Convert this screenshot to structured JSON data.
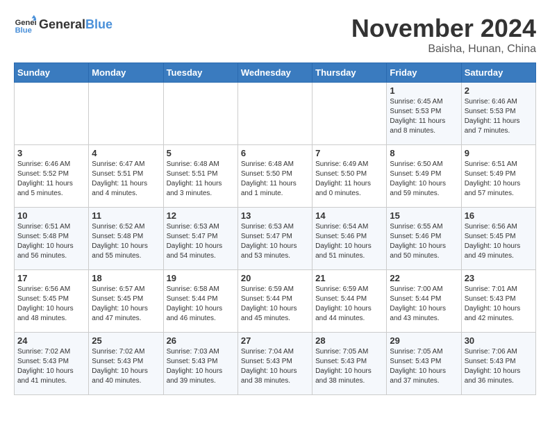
{
  "header": {
    "logo": "GeneralBlue",
    "month": "November 2024",
    "location": "Baisha, Hunan, China"
  },
  "weekdays": [
    "Sunday",
    "Monday",
    "Tuesday",
    "Wednesday",
    "Thursday",
    "Friday",
    "Saturday"
  ],
  "weeks": [
    [
      {
        "day": "",
        "info": ""
      },
      {
        "day": "",
        "info": ""
      },
      {
        "day": "",
        "info": ""
      },
      {
        "day": "",
        "info": ""
      },
      {
        "day": "",
        "info": ""
      },
      {
        "day": "1",
        "info": "Sunrise: 6:45 AM\nSunset: 5:53 PM\nDaylight: 11 hours and 8 minutes."
      },
      {
        "day": "2",
        "info": "Sunrise: 6:46 AM\nSunset: 5:53 PM\nDaylight: 11 hours and 7 minutes."
      }
    ],
    [
      {
        "day": "3",
        "info": "Sunrise: 6:46 AM\nSunset: 5:52 PM\nDaylight: 11 hours and 5 minutes."
      },
      {
        "day": "4",
        "info": "Sunrise: 6:47 AM\nSunset: 5:51 PM\nDaylight: 11 hours and 4 minutes."
      },
      {
        "day": "5",
        "info": "Sunrise: 6:48 AM\nSunset: 5:51 PM\nDaylight: 11 hours and 3 minutes."
      },
      {
        "day": "6",
        "info": "Sunrise: 6:48 AM\nSunset: 5:50 PM\nDaylight: 11 hours and 1 minute."
      },
      {
        "day": "7",
        "info": "Sunrise: 6:49 AM\nSunset: 5:50 PM\nDaylight: 11 hours and 0 minutes."
      },
      {
        "day": "8",
        "info": "Sunrise: 6:50 AM\nSunset: 5:49 PM\nDaylight: 10 hours and 59 minutes."
      },
      {
        "day": "9",
        "info": "Sunrise: 6:51 AM\nSunset: 5:49 PM\nDaylight: 10 hours and 57 minutes."
      }
    ],
    [
      {
        "day": "10",
        "info": "Sunrise: 6:51 AM\nSunset: 5:48 PM\nDaylight: 10 hours and 56 minutes."
      },
      {
        "day": "11",
        "info": "Sunrise: 6:52 AM\nSunset: 5:48 PM\nDaylight: 10 hours and 55 minutes."
      },
      {
        "day": "12",
        "info": "Sunrise: 6:53 AM\nSunset: 5:47 PM\nDaylight: 10 hours and 54 minutes."
      },
      {
        "day": "13",
        "info": "Sunrise: 6:53 AM\nSunset: 5:47 PM\nDaylight: 10 hours and 53 minutes."
      },
      {
        "day": "14",
        "info": "Sunrise: 6:54 AM\nSunset: 5:46 PM\nDaylight: 10 hours and 51 minutes."
      },
      {
        "day": "15",
        "info": "Sunrise: 6:55 AM\nSunset: 5:46 PM\nDaylight: 10 hours and 50 minutes."
      },
      {
        "day": "16",
        "info": "Sunrise: 6:56 AM\nSunset: 5:45 PM\nDaylight: 10 hours and 49 minutes."
      }
    ],
    [
      {
        "day": "17",
        "info": "Sunrise: 6:56 AM\nSunset: 5:45 PM\nDaylight: 10 hours and 48 minutes."
      },
      {
        "day": "18",
        "info": "Sunrise: 6:57 AM\nSunset: 5:45 PM\nDaylight: 10 hours and 47 minutes."
      },
      {
        "day": "19",
        "info": "Sunrise: 6:58 AM\nSunset: 5:44 PM\nDaylight: 10 hours and 46 minutes."
      },
      {
        "day": "20",
        "info": "Sunrise: 6:59 AM\nSunset: 5:44 PM\nDaylight: 10 hours and 45 minutes."
      },
      {
        "day": "21",
        "info": "Sunrise: 6:59 AM\nSunset: 5:44 PM\nDaylight: 10 hours and 44 minutes."
      },
      {
        "day": "22",
        "info": "Sunrise: 7:00 AM\nSunset: 5:44 PM\nDaylight: 10 hours and 43 minutes."
      },
      {
        "day": "23",
        "info": "Sunrise: 7:01 AM\nSunset: 5:43 PM\nDaylight: 10 hours and 42 minutes."
      }
    ],
    [
      {
        "day": "24",
        "info": "Sunrise: 7:02 AM\nSunset: 5:43 PM\nDaylight: 10 hours and 41 minutes."
      },
      {
        "day": "25",
        "info": "Sunrise: 7:02 AM\nSunset: 5:43 PM\nDaylight: 10 hours and 40 minutes."
      },
      {
        "day": "26",
        "info": "Sunrise: 7:03 AM\nSunset: 5:43 PM\nDaylight: 10 hours and 39 minutes."
      },
      {
        "day": "27",
        "info": "Sunrise: 7:04 AM\nSunset: 5:43 PM\nDaylight: 10 hours and 38 minutes."
      },
      {
        "day": "28",
        "info": "Sunrise: 7:05 AM\nSunset: 5:43 PM\nDaylight: 10 hours and 38 minutes."
      },
      {
        "day": "29",
        "info": "Sunrise: 7:05 AM\nSunset: 5:43 PM\nDaylight: 10 hours and 37 minutes."
      },
      {
        "day": "30",
        "info": "Sunrise: 7:06 AM\nSunset: 5:43 PM\nDaylight: 10 hours and 36 minutes."
      }
    ]
  ]
}
